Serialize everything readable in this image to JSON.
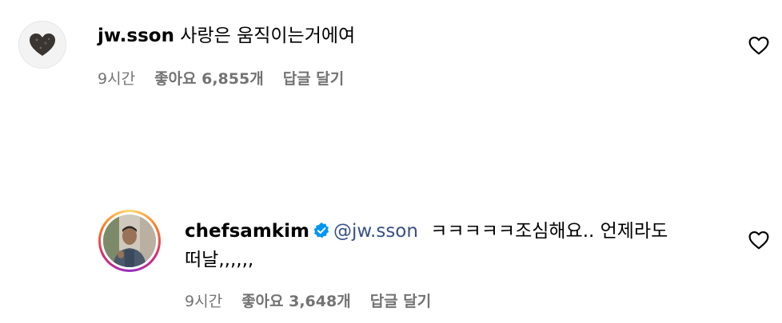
{
  "comments": [
    {
      "username": "jw.sson",
      "text": "사랑은 움직이는거에여",
      "time": "9시간",
      "likes": "좋아요 6,855개",
      "reply": "답글 달기",
      "avatar_icon": "heart-stone-avatar"
    },
    {
      "username": "chefsamkim",
      "verified": true,
      "mention": "@jw.sson",
      "text_line1": "ㅋㅋㅋㅋㅋ조심해요.. 언제라도",
      "text_line2": "떠날,,,,,,",
      "time": "9시간",
      "likes": "좋아요 3,648개",
      "reply": "답글 달기",
      "avatar_icon": "chef-photo-avatar"
    }
  ],
  "colors": {
    "accent_link": "#385185",
    "muted": "#737373",
    "verified": "#0095f6"
  }
}
